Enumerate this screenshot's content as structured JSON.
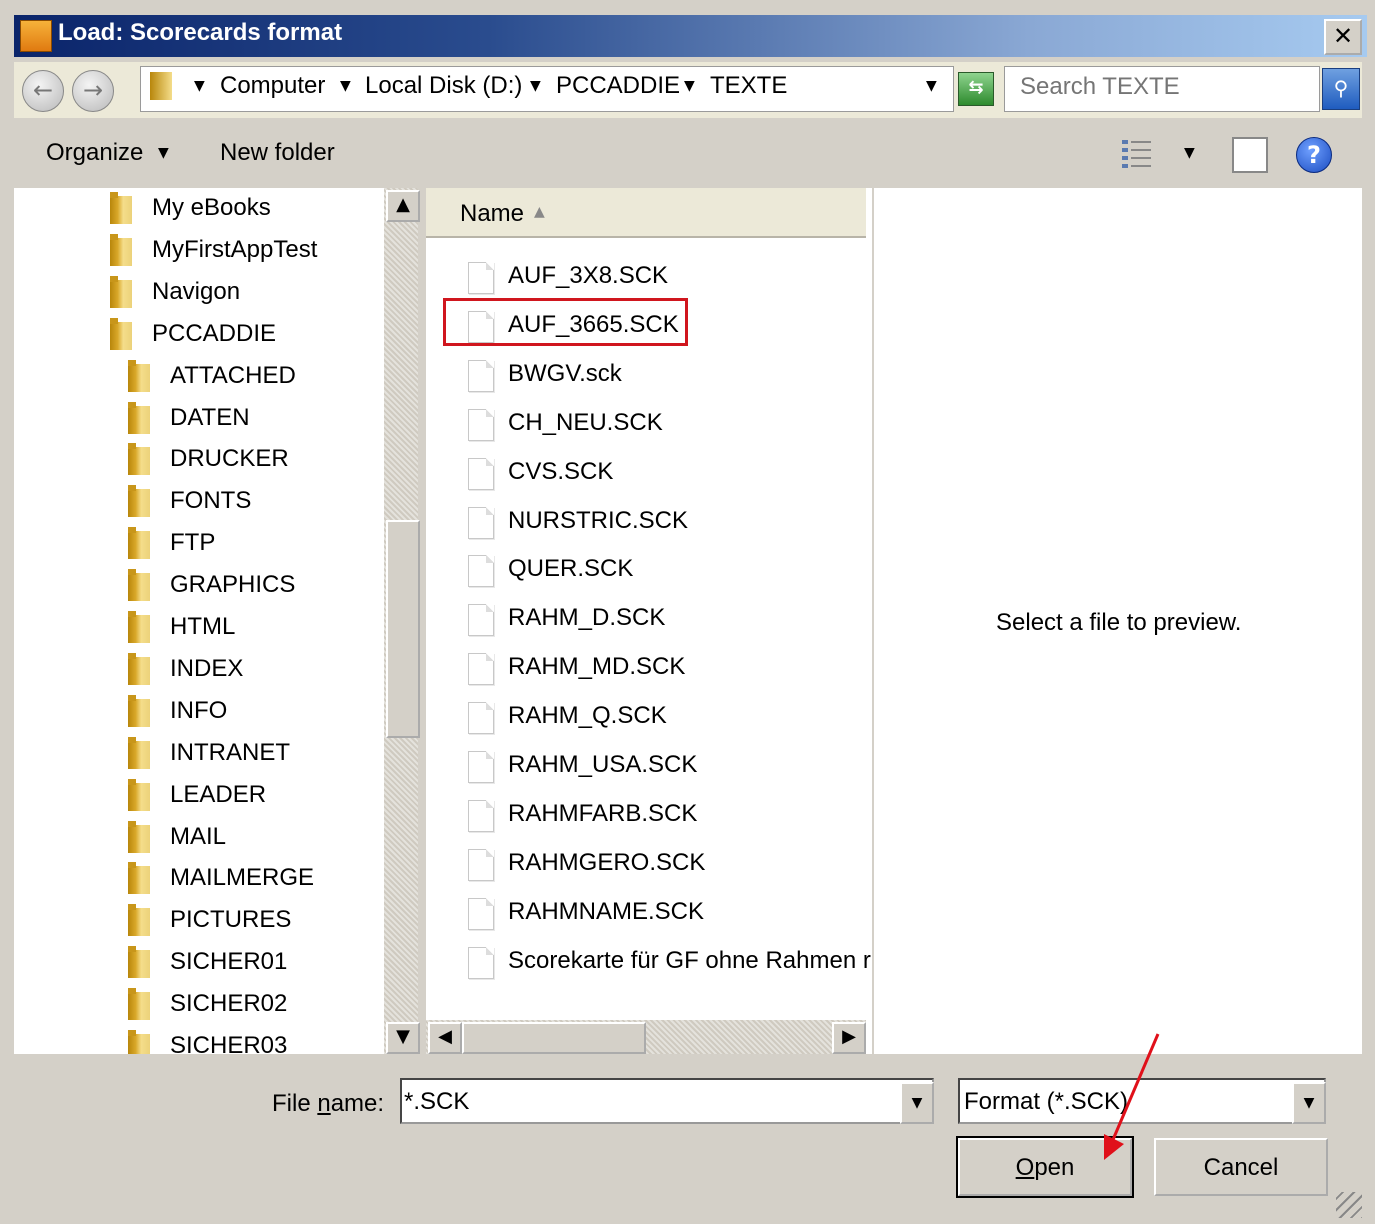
{
  "window": {
    "title": "Load: Scorecards format",
    "close": "✕"
  },
  "nav": {
    "back": "←",
    "forward": "→",
    "breadcrumbs": [
      "Computer",
      "Local Disk (D:)",
      "PCCADDIE",
      "TEXTE"
    ],
    "search_placeholder": "Search TEXTE"
  },
  "toolbar": {
    "organize": "Organize",
    "new_folder": "New folder",
    "help": "?"
  },
  "tree": {
    "items": [
      {
        "label": "My eBooks",
        "level": 0
      },
      {
        "label": "MyFirstAppTest",
        "level": 0
      },
      {
        "label": "Navigon",
        "level": 0
      },
      {
        "label": "PCCADDIE",
        "level": 0
      },
      {
        "label": "ATTACHED",
        "level": 1
      },
      {
        "label": "DATEN",
        "level": 1
      },
      {
        "label": "DRUCKER",
        "level": 1
      },
      {
        "label": "FONTS",
        "level": 1
      },
      {
        "label": "FTP",
        "level": 1
      },
      {
        "label": "GRAPHICS",
        "level": 1
      },
      {
        "label": "HTML",
        "level": 1
      },
      {
        "label": "INDEX",
        "level": 1
      },
      {
        "label": "INFO",
        "level": 1
      },
      {
        "label": "INTRANET",
        "level": 1
      },
      {
        "label": "LEADER",
        "level": 1
      },
      {
        "label": "MAIL",
        "level": 1
      },
      {
        "label": "MAILMERGE",
        "level": 1
      },
      {
        "label": "PICTURES",
        "level": 1
      },
      {
        "label": "SICHER01",
        "level": 1
      },
      {
        "label": "SICHER02",
        "level": 1
      },
      {
        "label": "SICHER03",
        "level": 1
      }
    ]
  },
  "filelist": {
    "column_name": "Name",
    "files": [
      "AUF_3X8.SCK",
      "AUF_3665.SCK",
      "BWGV.sck",
      "CH_NEU.SCK",
      "CVS.SCK",
      "NURSTRIC.SCK",
      "QUER.SCK",
      "RAHM_D.SCK",
      "RAHM_MD.SCK",
      "RAHM_Q.SCK",
      "RAHM_USA.SCK",
      "RAHMFARB.SCK",
      "RAHMGERO.SCK",
      "RAHMNAME.SCK",
      "Scorekarte für GF ohne Rahmen r"
    ],
    "highlighted_index": 1
  },
  "preview": {
    "text": "Select a file to preview."
  },
  "bottom": {
    "filename_label_pre": "File ",
    "filename_label_u": "n",
    "filename_label_post": "ame:",
    "filename_value": "*.SCK",
    "filter_value": "Format (*.SCK)",
    "open_u": "O",
    "open_rest": "pen",
    "cancel": "Cancel"
  },
  "colors": {
    "highlight": "#d0161e",
    "arrow": "#e0101a"
  }
}
